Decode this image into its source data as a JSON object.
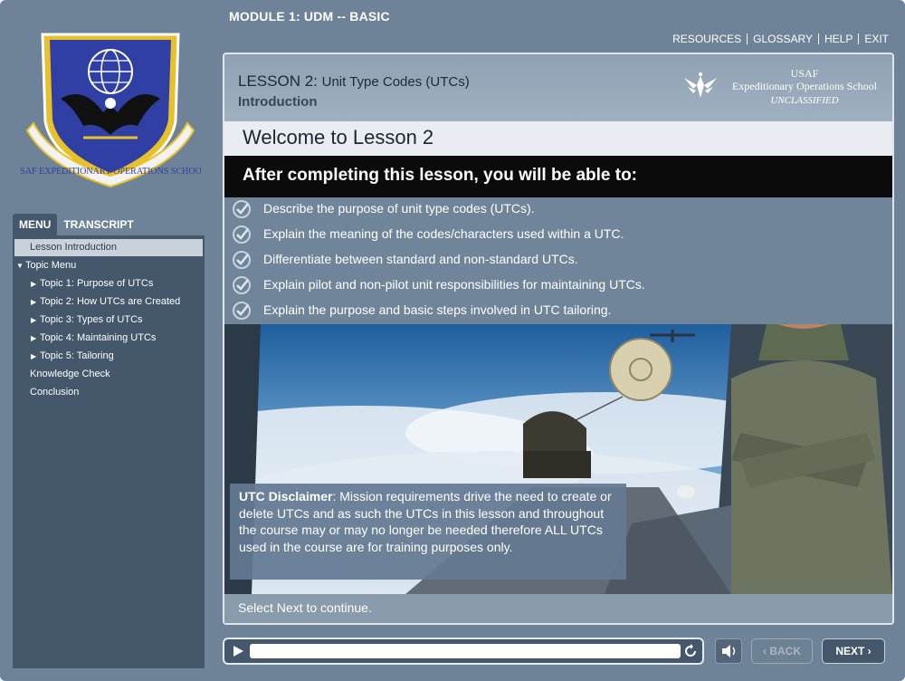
{
  "header": {
    "module_title": "MODULE 1: UDM -- BASIC",
    "links": [
      "RESOURCES",
      "GLOSSARY",
      "HELP",
      "EXIT"
    ]
  },
  "logo": {
    "text": "USAF EXPEDITIONARY OPERATIONS SCHOOL"
  },
  "sidebar": {
    "tabs": [
      "MENU",
      "TRANSCRIPT"
    ],
    "items": [
      {
        "label": "Lesson Introduction",
        "selected": true
      },
      {
        "label": "Topic Menu",
        "caret": "down"
      },
      {
        "label": "Topic 1: Purpose of UTCs",
        "caret": "right"
      },
      {
        "label": "Topic 2: How UTCs are Created",
        "caret": "right"
      },
      {
        "label": "Topic 3: Types of UTCs",
        "caret": "right"
      },
      {
        "label": "Topic 4: Maintaining UTCs",
        "caret": "right"
      },
      {
        "label": "Topic 5: Tailoring",
        "caret": "right"
      },
      {
        "label": "Knowledge Check"
      },
      {
        "label": "Conclusion"
      }
    ]
  },
  "lesson": {
    "number": "LESSON 2:",
    "title": "Unit Type Codes (UTCs)",
    "section": "Introduction",
    "brand": {
      "line1": "USAF",
      "line2": "Expeditionary Operations School",
      "classification": "UNCLASSIFIED"
    },
    "welcome": "Welcome to Lesson 2",
    "objectives_heading": "After completing this lesson, you will be able to:",
    "objectives": [
      "Describe the purpose of unit type codes (UTCs).",
      "Explain the meaning of the codes/characters used within a UTC.",
      "Differentiate between standard and non-standard UTCs.",
      "Explain pilot and non-pilot unit responsibilities for maintaining UTCs.",
      "Explain the purpose and basic steps involved in UTC tailoring."
    ],
    "disclaimer_label": "UTC Disclaimer",
    "disclaimer_text": ": Mission requirements drive the need to create or delete UTCs and as such the UTCs in this lesson and throughout the course may or may no longer be needed therefore ALL UTCs used in the course are for training purposes only.",
    "continue": "Select Next to continue."
  },
  "controls": {
    "back": "BACK",
    "next": "NEXT",
    "progress": 1.0
  },
  "colors": {
    "frame": "#6f8398",
    "sidebar": "#44576b",
    "objectives_bar": "#0b0b0b"
  }
}
